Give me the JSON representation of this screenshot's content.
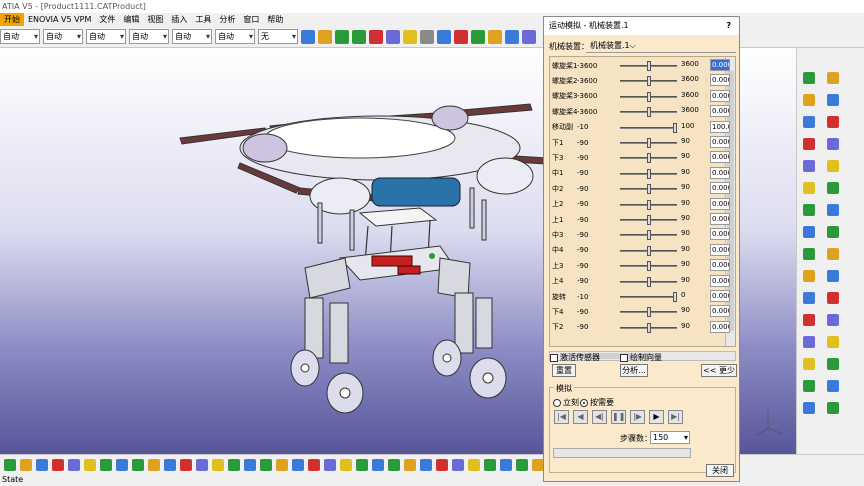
{
  "window": {
    "title": "ATIA V5 - [Product1111.CATProduct]"
  },
  "menu": [
    {
      "label": "开始",
      "active": true
    },
    {
      "label": "ENOVIA V5 VPM",
      "active": false
    },
    {
      "label": "文件",
      "active": false
    },
    {
      "label": "编辑",
      "active": false
    },
    {
      "label": "视图",
      "active": false
    },
    {
      "label": "插入",
      "active": false
    },
    {
      "label": "工具",
      "active": false
    },
    {
      "label": "分析",
      "active": false
    },
    {
      "label": "窗口",
      "active": false
    },
    {
      "label": "帮助",
      "active": false
    }
  ],
  "combos": [
    "自动",
    "自动",
    "自动",
    "自动",
    "自动",
    "自动",
    "无"
  ],
  "dialog": {
    "title": "运动模拟 - 机械装置.1",
    "help": "?",
    "mechanism_label": "机械装置：",
    "mechanism_value": "机械装置.1",
    "commands": [
      {
        "name": "螺旋桨1",
        "min": "-3600",
        "max": "3600",
        "value": "0.000",
        "pos": 0.5,
        "selected": true
      },
      {
        "name": "螺旋桨2",
        "min": "-3600",
        "max": "3600",
        "value": "0.000",
        "pos": 0.5,
        "selected": false
      },
      {
        "name": "螺旋桨3",
        "min": "-3600",
        "max": "3600",
        "value": "0.000",
        "pos": 0.5,
        "selected": false
      },
      {
        "name": "螺旋桨4",
        "min": "-3600",
        "max": "3600",
        "value": "0.000",
        "pos": 0.5,
        "selected": false
      },
      {
        "name": "移动副",
        "min": "-10",
        "max": "100",
        "value": "100.0",
        "pos": 1.0,
        "selected": false
      },
      {
        "name": "下1",
        "min": "-90",
        "max": "90",
        "value": "0.000",
        "pos": 0.5,
        "selected": false
      },
      {
        "name": "下3",
        "min": "-90",
        "max": "90",
        "value": "0.000",
        "pos": 0.5,
        "selected": false
      },
      {
        "name": "中1",
        "min": "-90",
        "max": "90",
        "value": "0.000",
        "pos": 0.5,
        "selected": false
      },
      {
        "name": "中2",
        "min": "-90",
        "max": "90",
        "value": "0.000",
        "pos": 0.5,
        "selected": false
      },
      {
        "name": "上2",
        "min": "-90",
        "max": "90",
        "value": "0.000",
        "pos": 0.5,
        "selected": false
      },
      {
        "name": "上1",
        "min": "-90",
        "max": "90",
        "value": "0.000",
        "pos": 0.5,
        "selected": false
      },
      {
        "name": "中3",
        "min": "-90",
        "max": "90",
        "value": "0.000",
        "pos": 0.5,
        "selected": false
      },
      {
        "name": "中4",
        "min": "-90",
        "max": "90",
        "value": "0.000",
        "pos": 0.5,
        "selected": false
      },
      {
        "name": "上3",
        "min": "-90",
        "max": "90",
        "value": "0.000",
        "pos": 0.5,
        "selected": false
      },
      {
        "name": "上4",
        "min": "-90",
        "max": "90",
        "value": "0.000",
        "pos": 0.5,
        "selected": false
      },
      {
        "name": "旋转",
        "min": "-10",
        "max": "0",
        "value": "0.000",
        "pos": 1.0,
        "selected": false
      },
      {
        "name": "下4",
        "min": "-90",
        "max": "90",
        "value": "0.000",
        "pos": 0.5,
        "selected": false
      },
      {
        "name": "下2",
        "min": "-90",
        "max": "90",
        "value": "0.000",
        "pos": 0.5,
        "selected": false
      }
    ],
    "activate_sensors": "激活传感器",
    "plot_vectors": "绘制向量",
    "reset_button": "重置",
    "analysis_button": "分析...",
    "less_button": "<< 更少",
    "simulation_group": "模拟",
    "immediate_label": "立刻",
    "on_request_label": "按需要",
    "step_label": "步骤数：",
    "step_value": "150",
    "close_button": "关闭"
  },
  "status": {
    "text": "State"
  },
  "colors": {
    "menu_active": "#f4a400",
    "dialog_bg": "#fbe9cc",
    "selected_field": "#3a6fd8"
  }
}
